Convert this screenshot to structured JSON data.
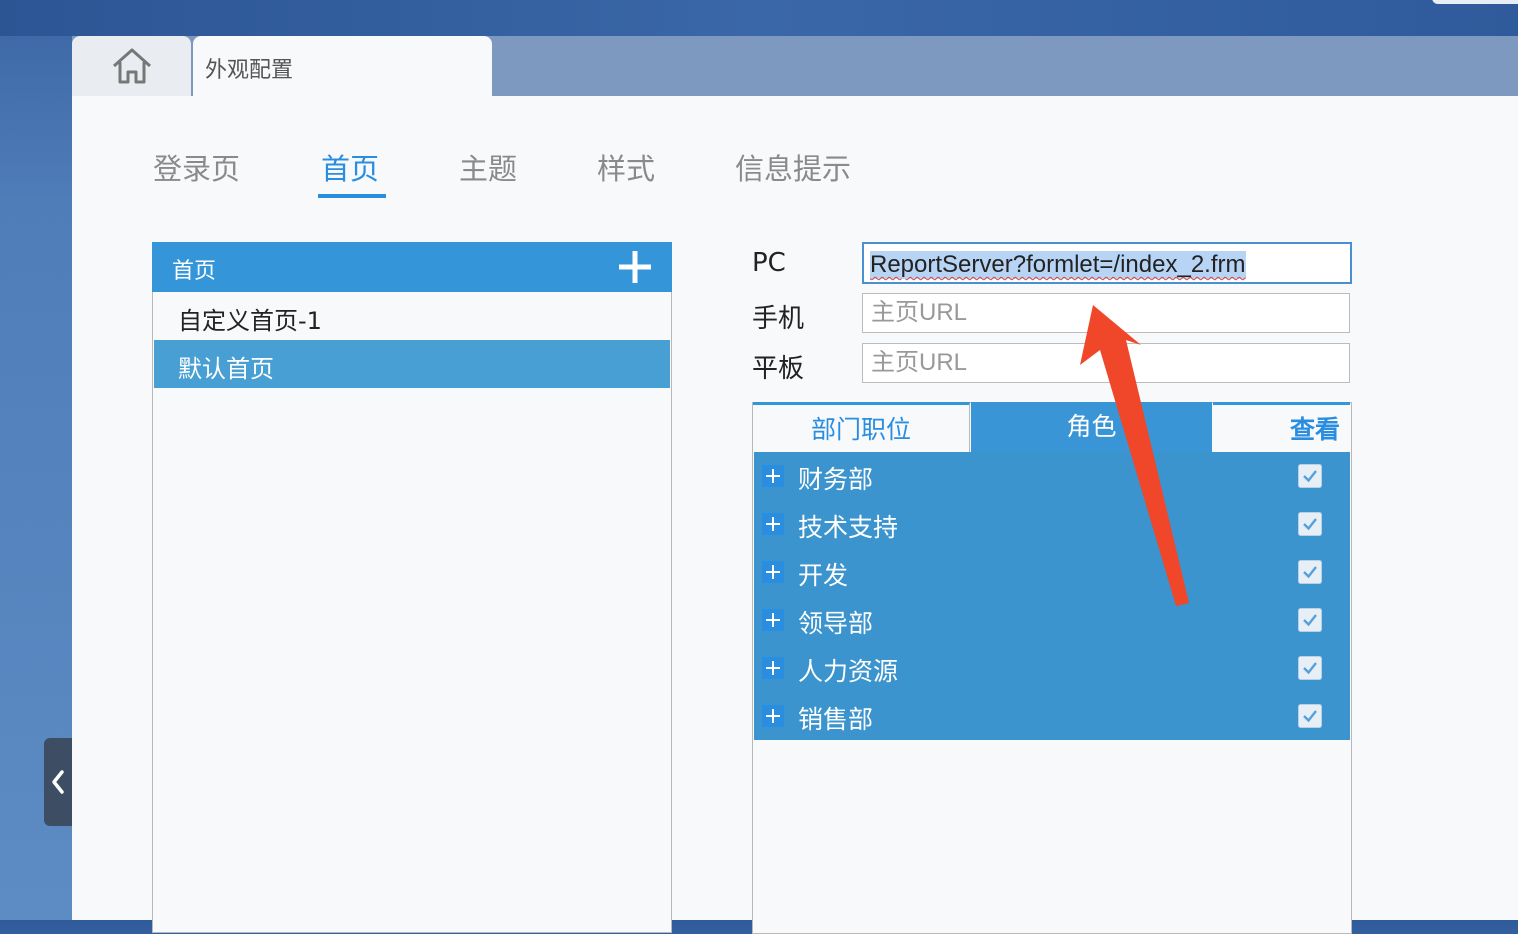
{
  "window": {
    "home_tab_icon": "home-icon",
    "active_tab_label": "外观配置"
  },
  "subtabs": [
    {
      "label": "登录页",
      "active": false
    },
    {
      "label": "首页",
      "active": true
    },
    {
      "label": "主题",
      "active": false
    },
    {
      "label": "样式",
      "active": false
    },
    {
      "label": "信息提示",
      "active": false
    }
  ],
  "homepage_list": {
    "header_title": "首页",
    "add_icon": "plus-icon",
    "items": [
      {
        "label": "自定义首页-1",
        "selected": false
      },
      {
        "label": "默认首页",
        "selected": true
      }
    ]
  },
  "url_form": {
    "pc_label": "PC",
    "pc_value": "ReportServer?formlet=/index_2.frm",
    "mobile_label": "手机",
    "mobile_placeholder": "主页URL",
    "tablet_label": "平板",
    "tablet_placeholder": "主页URL"
  },
  "permission_panel": {
    "tabs": [
      {
        "label": "部门职位",
        "active": false
      },
      {
        "label": "角色",
        "active": true
      },
      {
        "label": "查看",
        "active": false
      }
    ],
    "tree": [
      {
        "label": "财务部",
        "checked": true
      },
      {
        "label": "技术支持",
        "checked": true
      },
      {
        "label": "开发",
        "checked": true
      },
      {
        "label": "领导部",
        "checked": true
      },
      {
        "label": "人力资源",
        "checked": true
      },
      {
        "label": "销售部",
        "checked": true
      }
    ]
  },
  "colors": {
    "accent": "#2a8ee0",
    "header_blue": "#3495d8",
    "selected_row": "#479fd3",
    "annotation_arrow": "#f0462a"
  }
}
